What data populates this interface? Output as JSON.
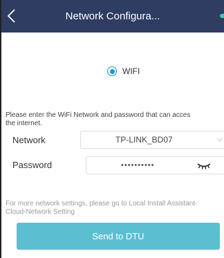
{
  "header": {
    "title": "Network Configura...",
    "back_icon": "chevron-left-icon",
    "background_color": "#2f3d63"
  },
  "mode": {
    "wifi_label": "WIFI",
    "selected": true,
    "accent_color": "#1296db"
  },
  "instruction": "Please enter the WiFi Network and password that can acces\nthe  internet.",
  "form": {
    "network_label": "Network",
    "network_value": "TP-LINK_BD07",
    "password_label": "Password",
    "password_value": "••••••••••",
    "password_toggle_icon": "eye-closed-icon"
  },
  "more_settings": "For more network settings, please go to Local Install Assistant-Cloud-Network Setting",
  "actions": {
    "send_label": "Send to DTU",
    "button_color": "#5bbfd1"
  }
}
